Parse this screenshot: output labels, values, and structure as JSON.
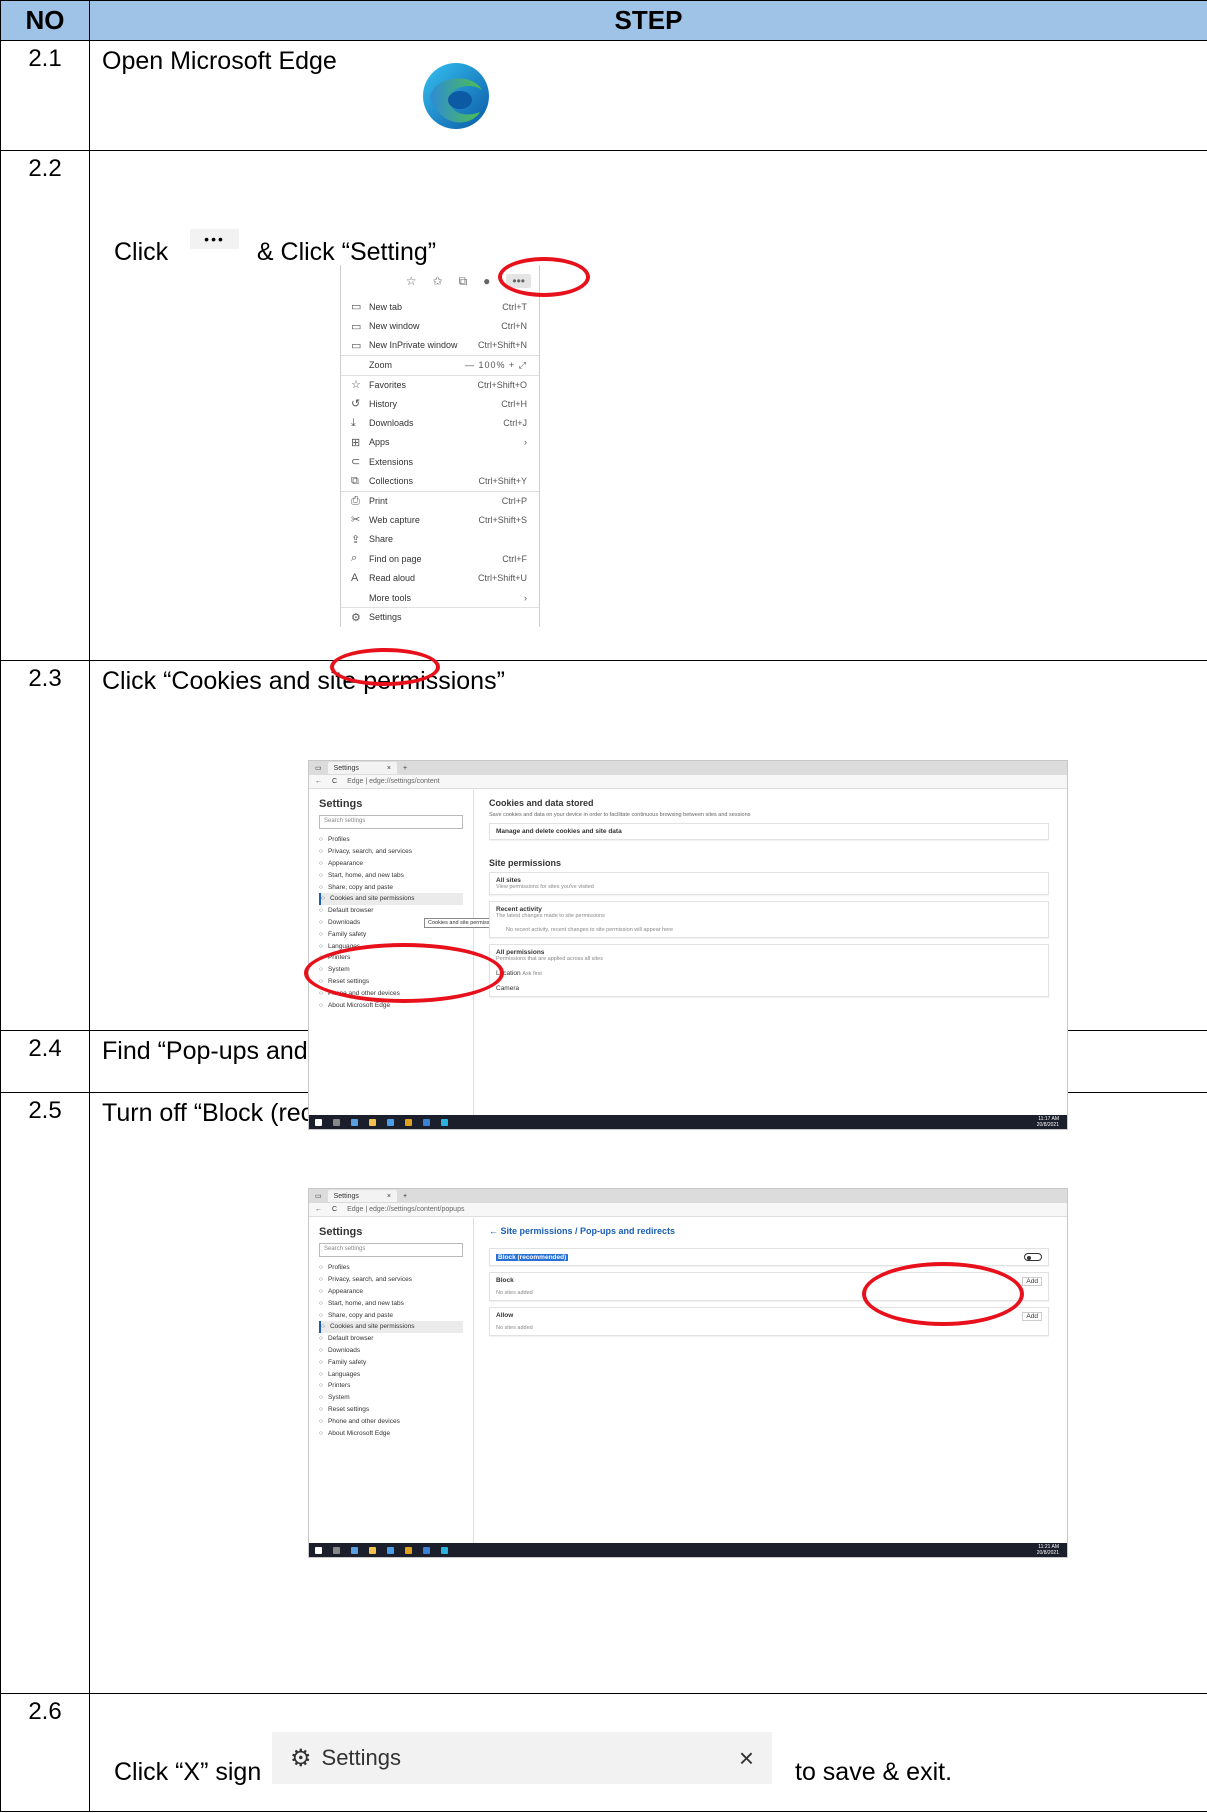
{
  "header": {
    "no": "NO",
    "step": "STEP"
  },
  "rows": [
    {
      "no": "2.1",
      "text": "Open Microsoft Edge"
    },
    {
      "no": "2.2",
      "click": "Click",
      "text": "& Click “Setting”"
    },
    {
      "no": "2.3",
      "text": "Click “Cookies and site permissions”"
    },
    {
      "no": "2.4",
      "text": "Find “Pop-ups and redirects” on the right & Click on it"
    },
    {
      "no": "2.5",
      "text": "Turn off “Block (recommended)” as picture below :"
    },
    {
      "no": "2.6",
      "pre": "Click “X” sign",
      "post": "to save & exit."
    }
  ],
  "ellipsis_glyph": "•••",
  "edge_menu": {
    "items": [
      {
        "icon": "▭",
        "label": "New tab",
        "shortcut": "Ctrl+T"
      },
      {
        "icon": "▭",
        "label": "New window",
        "shortcut": "Ctrl+N"
      },
      {
        "icon": "▭",
        "label": "New InPrivate window",
        "shortcut": "Ctrl+Shift+N"
      },
      {
        "icon": "",
        "label": "Zoom",
        "shortcut": "—   100%  +   ⤢"
      },
      {
        "icon": "☆",
        "label": "Favorites",
        "shortcut": "Ctrl+Shift+O"
      },
      {
        "icon": "↺",
        "label": "History",
        "shortcut": "Ctrl+H"
      },
      {
        "icon": "⤓",
        "label": "Downloads",
        "shortcut": "Ctrl+J"
      },
      {
        "icon": "⊞",
        "label": "Apps",
        "shortcut": "›"
      },
      {
        "icon": "⊂",
        "label": "Extensions",
        "shortcut": ""
      },
      {
        "icon": "⧉",
        "label": "Collections",
        "shortcut": "Ctrl+Shift+Y"
      },
      {
        "icon": "⎙",
        "label": "Print",
        "shortcut": "Ctrl+P"
      },
      {
        "icon": "✂",
        "label": "Web capture",
        "shortcut": "Ctrl+Shift+S"
      },
      {
        "icon": "⇪",
        "label": "Share",
        "shortcut": ""
      },
      {
        "icon": "⌕",
        "label": "Find on page",
        "shortcut": "Ctrl+F"
      },
      {
        "icon": "A",
        "label": "Read aloud",
        "shortcut": "Ctrl+Shift+U"
      },
      {
        "icon": "",
        "label": "More tools",
        "shortcut": "›"
      },
      {
        "icon": "⚙",
        "label": "Settings",
        "shortcut": ""
      }
    ]
  },
  "browser1": {
    "tab_title": "Settings",
    "url": "Edge  |  edge://settings/content",
    "sidebar_title": "Settings",
    "search_placeholder": "Search settings",
    "sidebar": [
      "Profiles",
      "Privacy, search, and services",
      "Appearance",
      "Start, home, and new tabs",
      "Share, copy and paste",
      "Cookies and site permissions",
      "Default browser",
      "Downloads",
      "Family safety",
      "Languages",
      "Printers",
      "System",
      "Reset settings",
      "Phone and other devices",
      "About Microsoft Edge"
    ],
    "tooltip": "Cookies and site permissions",
    "main_title": "Cookies and data stored",
    "main_desc": "Save cookies and data on your device in order to facilitate continuous browsing between sites and sessions",
    "manage": "Manage and delete cookies and site data",
    "perm_title": "Site permissions",
    "all_sites": "All sites",
    "all_sites_desc": "View permissions for sites you've visited",
    "recent": "Recent activity",
    "recent_desc": "The latest changes made to site permissions",
    "recent_empty": "No recent activity, recent changes to site permission will appear here",
    "all_perms": "All permissions",
    "all_perms_desc": "Permissions that are applied across all sites",
    "location": "Location",
    "location_desc": "Ask first",
    "camera": "Camera",
    "clock": "11:17 AM\n20/8/2021"
  },
  "browser2": {
    "tab_title": "Settings",
    "url": "Edge  |  edge://settings/content/popups",
    "sidebar_title": "Settings",
    "search_placeholder": "Search settings",
    "sidebar": [
      "Profiles",
      "Privacy, search, and services",
      "Appearance",
      "Start, home, and new tabs",
      "Share, copy and paste",
      "Cookies and site permissions",
      "Default browser",
      "Downloads",
      "Family safety",
      "Languages",
      "Printers",
      "System",
      "Reset settings",
      "Phone and other devices",
      "About Microsoft Edge"
    ],
    "breadcrumb": "← Site permissions / Pop-ups and redirects",
    "block_rec": "Block (recommended)",
    "block": "Block",
    "allow": "Allow",
    "add": "Add",
    "no_sites": "No sites added",
    "clock": "11:21 AM\n20/8/2021"
  },
  "tab26": {
    "label": "Settings",
    "close": "×"
  },
  "colors": {
    "header_bg": "#9ec3e6",
    "highlight": "#e8101a",
    "edge_blue": "#0c59a4",
    "edge_green": "#4fbf4f"
  }
}
